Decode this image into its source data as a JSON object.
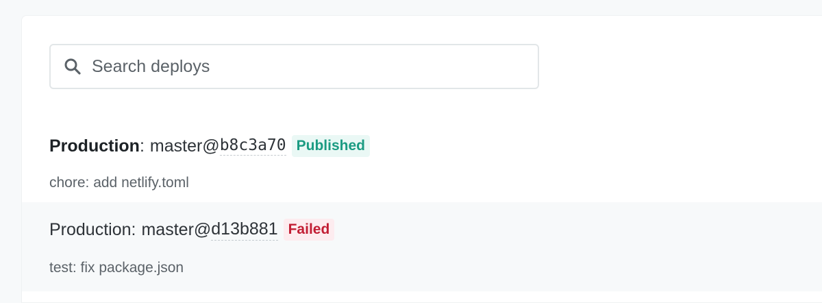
{
  "search": {
    "placeholder": "Search deploys",
    "icon": "search-icon"
  },
  "deploys": [
    {
      "context": "Production",
      "branch": "master",
      "sha": "b8c3a70",
      "status": "Published",
      "status_color": "#1a9b82",
      "message": "chore: add netlify.toml"
    },
    {
      "context": "Production",
      "branch": "master",
      "sha": "d13b881",
      "status": "Failed",
      "status_color": "#c21e34",
      "message": "test: fix package.json"
    }
  ]
}
